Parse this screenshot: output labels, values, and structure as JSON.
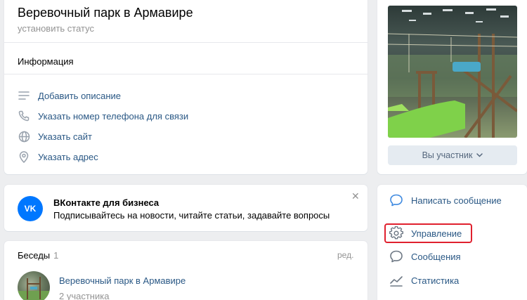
{
  "header": {
    "group_name": "Веревочный парк в Армавире",
    "set_status": "установить статус"
  },
  "info": {
    "title": "Информация",
    "items": [
      {
        "icon": "list-icon",
        "label": "Добавить описание"
      },
      {
        "icon": "phone-icon",
        "label": "Указать номер телефона для связи"
      },
      {
        "icon": "globe-icon",
        "label": "Указать сайт"
      },
      {
        "icon": "location-pin-icon",
        "label": "Указать адрес"
      }
    ]
  },
  "photo_card": {
    "member_button": "Вы участник"
  },
  "business": {
    "logo": "VK",
    "title": "ВКонтакте для бизнеса",
    "text": "Подписывайтесь на новости, читайте статьи, задавайте вопросы",
    "close": "✕"
  },
  "chats": {
    "title": "Беседы",
    "count": "1",
    "edit": "ред.",
    "items": [
      {
        "name": "Веревочный парк в Армавире",
        "members": "2 участника"
      }
    ]
  },
  "menu": {
    "items": [
      {
        "icon": "message-bubble-icon",
        "label": "Написать сообщение"
      },
      {
        "icon": "gear-icon",
        "label": "Управление"
      },
      {
        "icon": "messages-icon",
        "label": "Сообщения"
      },
      {
        "icon": "stats-icon",
        "label": "Статистика"
      }
    ],
    "highlight_color": "#e0202e"
  },
  "colors": {
    "link": "#2a5885",
    "muted": "#939393",
    "background": "#edeef0",
    "vk_blue": "#0077ff"
  }
}
